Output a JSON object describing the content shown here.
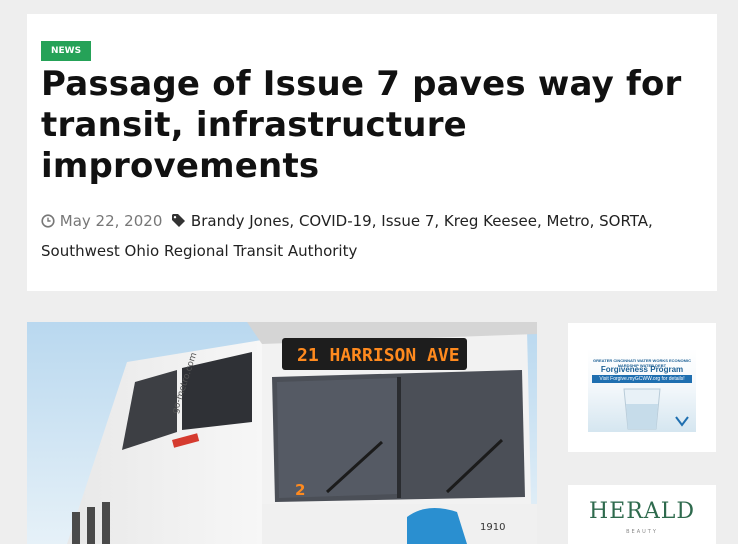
{
  "article": {
    "category": "NEWS",
    "title": "Passage of Issue 7 paves way for transit, infrastructure improvements",
    "date": "May 22, 2020",
    "tags": [
      "Brandy Jones",
      "COVID-19",
      "Issue 7",
      "Kreg Keesee",
      "Metro",
      "SORTA",
      "Southwest Ohio Regional Transit Authority"
    ],
    "featured_image": {
      "route_sign": "21  HARRISON AVE",
      "side_text": "go-metro.com",
      "route_number": "2",
      "bus_number": "1910"
    }
  },
  "sidebar": {
    "ad1": {
      "small_text": "GREATER CINCINNATI WATER WORKS ECONOMIC HARDSHIP WATER DEBT",
      "title": "Forgiveness Program",
      "link_text": "Visit Forgive.myGCWW.org for details!"
    },
    "ad2": {
      "logo": "HERALD",
      "sub": "BEAUTY"
    }
  },
  "colors": {
    "badge_bg": "#25a258",
    "page_bg": "#eeeeee",
    "bus_orange": "#ff8a1e"
  },
  "icons": {
    "date": "clock-icon",
    "tags": "tag-icon"
  }
}
